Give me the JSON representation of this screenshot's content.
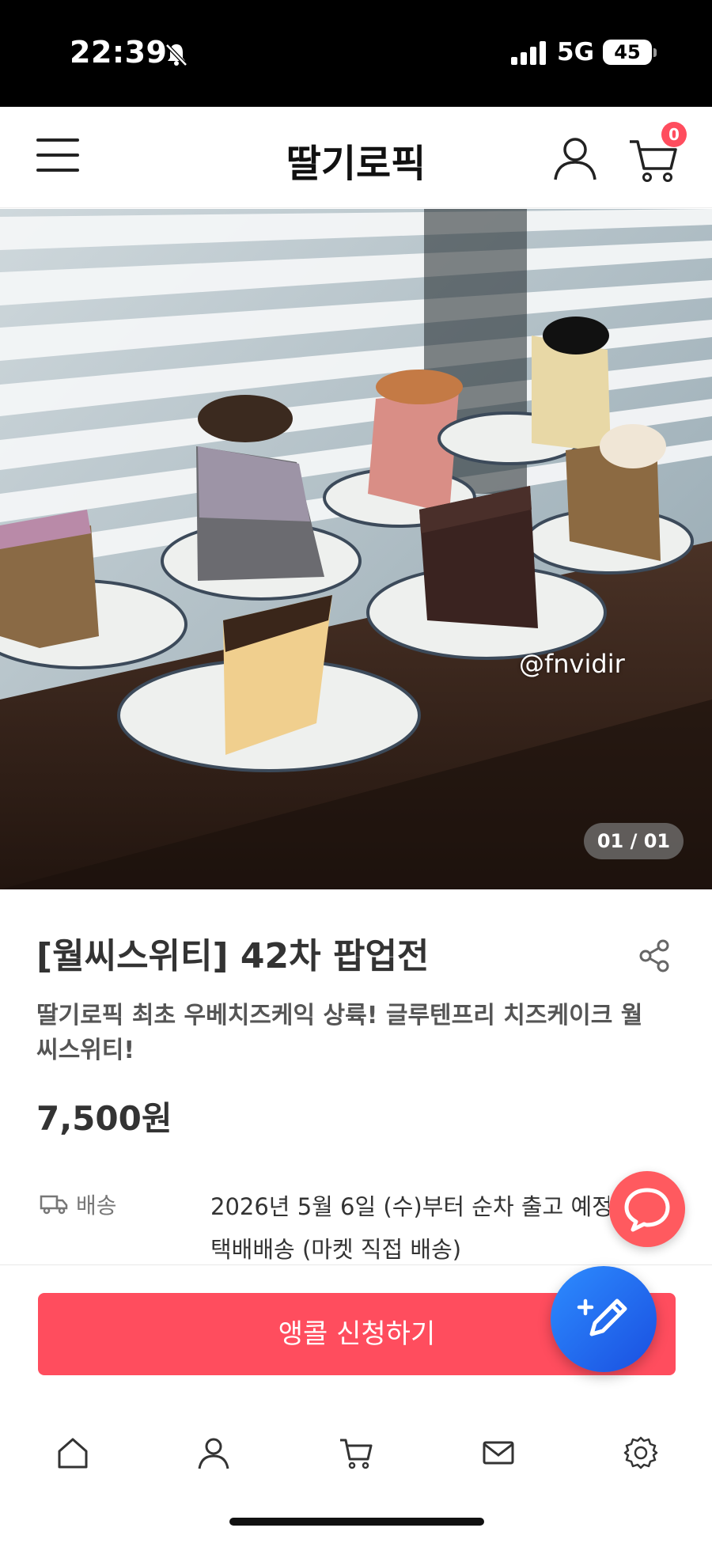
{
  "status_bar": {
    "time": "22:39",
    "network": "5G",
    "battery": "45"
  },
  "header": {
    "brand": "딸기로픽",
    "cart_count": "0",
    "icons": [
      "menu-icon",
      "user-icon",
      "cart-icon"
    ]
  },
  "hero": {
    "watermark": "@fnvidir",
    "counter": "01 / 01"
  },
  "product": {
    "title": "[월씨스위티] 42차 팝업전",
    "subtitle": "딸기로픽 최초 우베치즈케익 상륙! 글루텐프리 치즈케이크 월씨스위티!",
    "price": "7,500원"
  },
  "shipping": {
    "label": "배송",
    "line1": "2026년 5월 6일 (수)부터 순차 출고 예정",
    "line2": "택배배송 (마켓 직접 배송)"
  },
  "action": {
    "apply_label": "앵콜 신청하기"
  },
  "tabbar": {
    "icons": [
      "home-icon",
      "user-icon",
      "cart-icon",
      "mail-icon",
      "settings-icon"
    ]
  },
  "colors": {
    "accent": "#ff4d5e",
    "chat_fab": "#ff5a5f",
    "write_fab": "#2d6cf0"
  }
}
